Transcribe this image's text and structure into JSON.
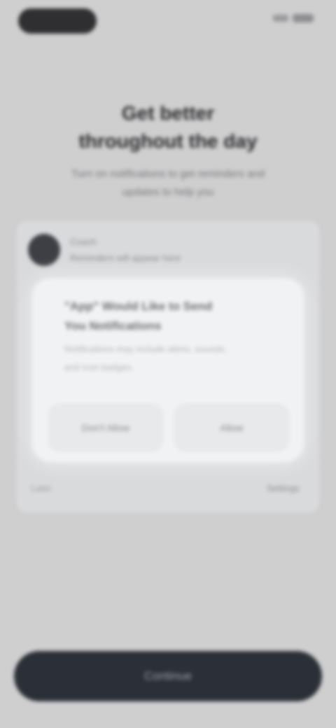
{
  "page": {
    "title_line1": "Get better",
    "title_line2": "throughout the day",
    "subtitle_line1": "Turn on notifications to get reminders and",
    "subtitle_line2": "updates to help you"
  },
  "card": {
    "profile_name": "Coach",
    "profile_desc": "Reminders will appear here",
    "footer_left": "Later",
    "footer_right": "Settings"
  },
  "dialog": {
    "title_line1": "\"App\" Would Like to Send",
    "title_line2": "You Notifications",
    "body_line1": "Notifications may include alerts, sounds,",
    "body_line2": "and icon badges.",
    "deny_label": "Don't Allow",
    "allow_label": "Allow"
  },
  "cta": {
    "label": "Continue"
  },
  "colors": {
    "background": "#cfcfd0",
    "cta": "#2b2f37",
    "dialog": "#f1f2f4"
  }
}
